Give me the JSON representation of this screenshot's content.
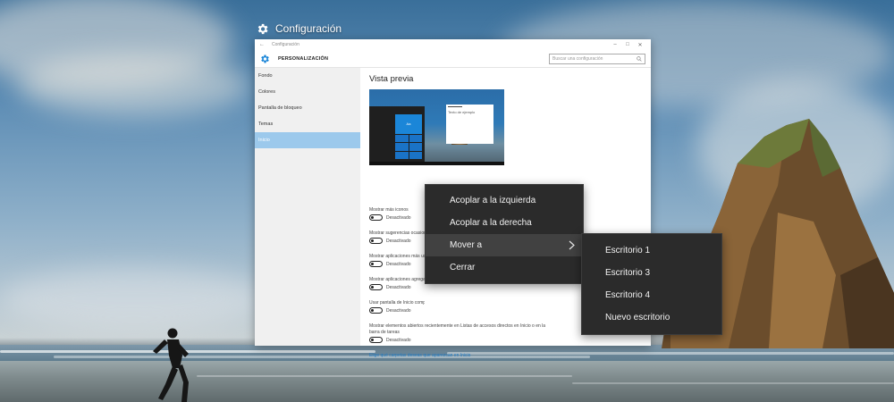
{
  "app": {
    "title": "Configuración"
  },
  "window": {
    "titlebar_text": "Configuración",
    "back_glyph": "←",
    "minimize_glyph": "–",
    "maximize_glyph": "□",
    "close_glyph": "✕",
    "section_title": "PERSONALIZACIÓN",
    "search_placeholder": "Buscar una configuración"
  },
  "sidebar": {
    "items": [
      {
        "label": "Fondo",
        "active": false
      },
      {
        "label": "Colores",
        "active": false
      },
      {
        "label": "Pantalla de bloqueo",
        "active": false
      },
      {
        "label": "Temas",
        "active": false
      },
      {
        "label": "Inicio",
        "active": true
      }
    ]
  },
  "content": {
    "heading": "Vista previa",
    "preview": {
      "tile_label": "Aa",
      "window_text": "Texto de ejemplo"
    },
    "options": [
      {
        "label": "Mostrar más iconos",
        "state": "Desactivado"
      },
      {
        "label": "Mostrar sugerencias ocasionalmente en Inicio",
        "state": "Desactivado"
      },
      {
        "label": "Mostrar aplicaciones más usadas",
        "state": "Desactivado"
      },
      {
        "label": "Mostrar aplicaciones agregadas recientemente",
        "state": "Desactivado"
      },
      {
        "label": "Usar pantalla de Inicio completa",
        "state": "Desactivado"
      },
      {
        "label": "Mostrar elementos abiertos recientemente en Listas de accesos directos en Inicio o en la barra de tareas",
        "state": "Desactivado"
      }
    ],
    "link": "Elige qué carpetas deseas que aparezcan en Inicio"
  },
  "context_menu": {
    "items": [
      {
        "label": "Acoplar a la izquierda",
        "has_submenu": false,
        "highlighted": false
      },
      {
        "label": "Acoplar a la derecha",
        "has_submenu": false,
        "highlighted": false
      },
      {
        "label": "Mover a",
        "has_submenu": true,
        "highlighted": true
      },
      {
        "label": "Cerrar",
        "has_submenu": false,
        "highlighted": false
      }
    ]
  },
  "submenu": {
    "items": [
      {
        "label": "Escritorio 1"
      },
      {
        "label": "Escritorio 3"
      },
      {
        "label": "Escritorio 4"
      },
      {
        "label": "Nuevo escritorio"
      }
    ]
  },
  "colors": {
    "menu_bg": "#2b2b2b",
    "menu_hover": "#414141",
    "sidebar_active": "#9cc9ec",
    "accent": "#1b86d8",
    "link": "#1e7ac4"
  },
  "icons": {
    "app": "gear-icon",
    "header": "gear-icon",
    "search": "search-icon",
    "submenu": "chevron-right-icon",
    "toggle": "toggle-off-icon"
  }
}
